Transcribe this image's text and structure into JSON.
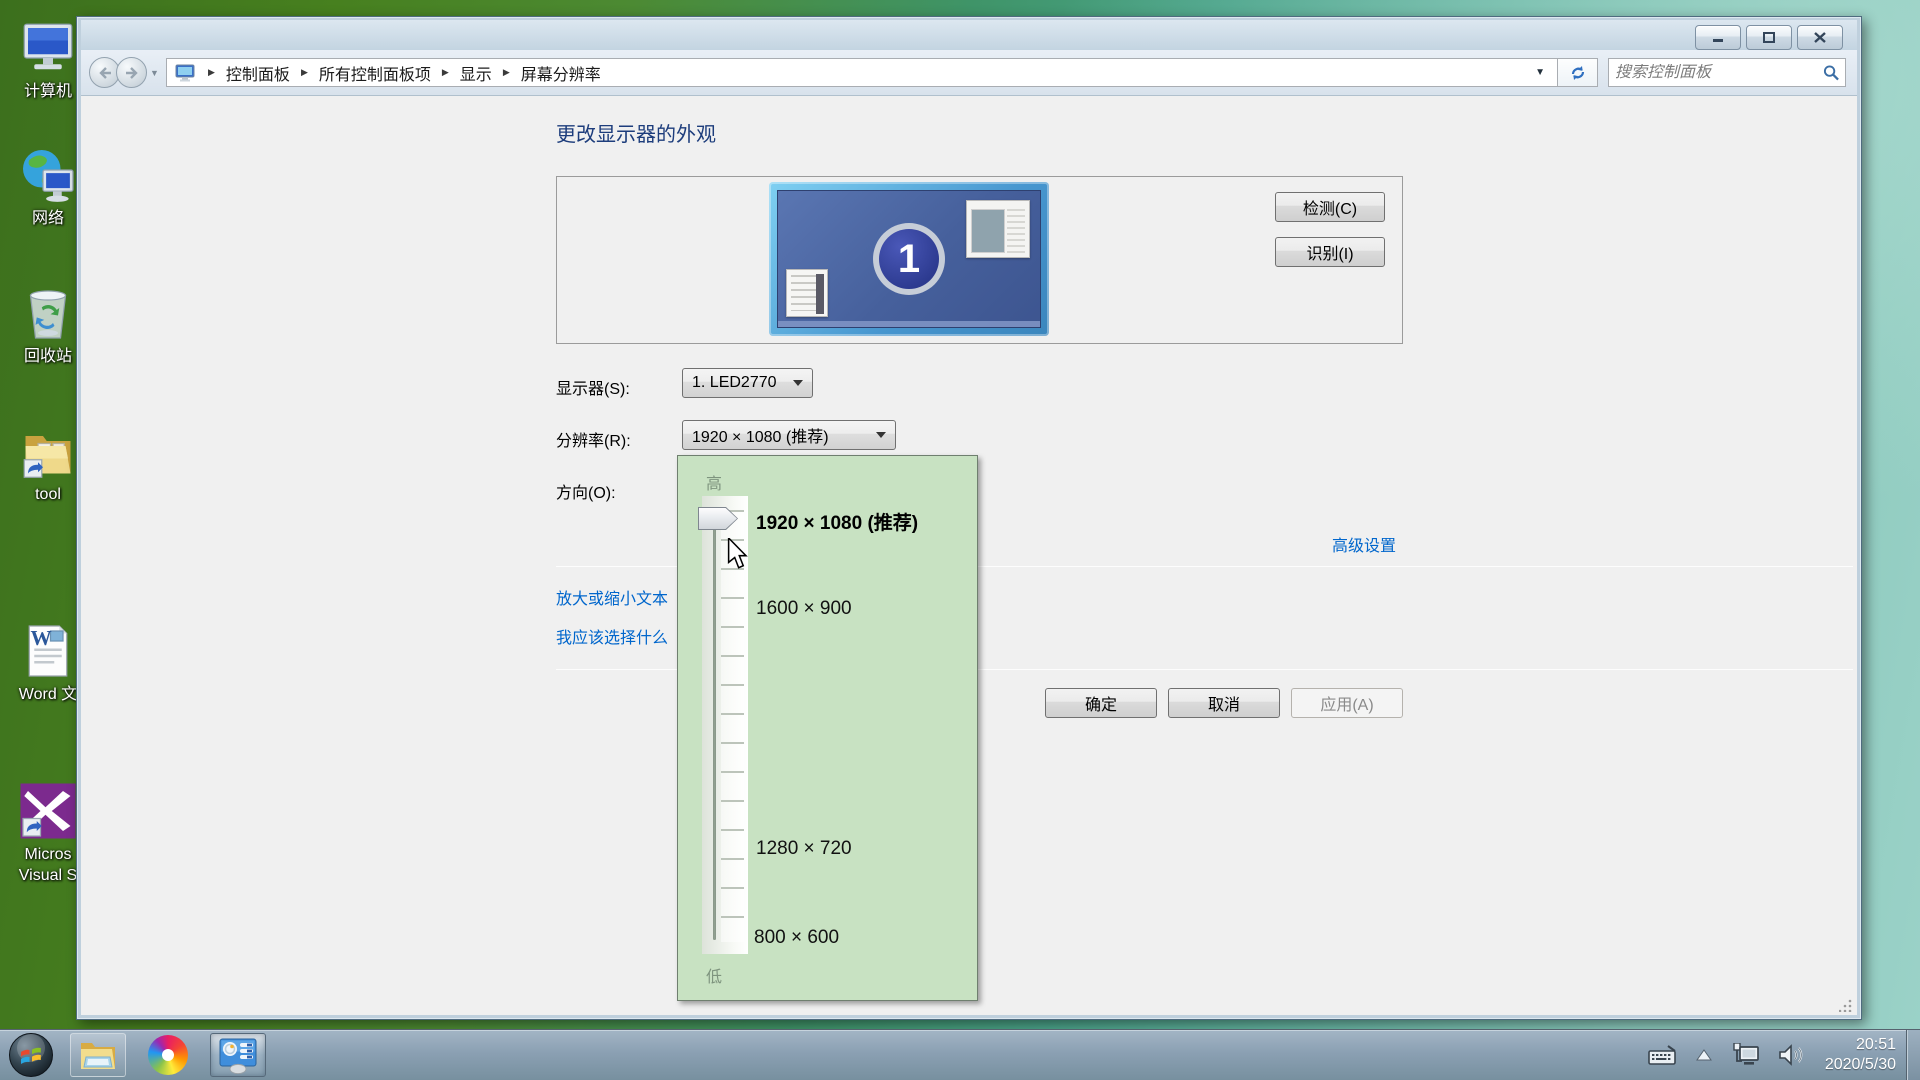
{
  "desktop": {
    "icons": [
      {
        "name": "computer",
        "label": "计算机"
      },
      {
        "name": "network",
        "label": "网络"
      },
      {
        "name": "recycle-bin",
        "label": "回收站"
      },
      {
        "name": "tool-folder",
        "label": "tool"
      },
      {
        "name": "word-doc",
        "label": "Word 文"
      },
      {
        "name": "visual-studio",
        "label": "Micros",
        "label2": "Visual S"
      }
    ]
  },
  "window": {
    "breadcrumb": {
      "items": [
        "控制面板",
        "所有控制面板项",
        "显示",
        "屏幕分辨率"
      ]
    },
    "search": {
      "placeholder": "搜索控制面板"
    },
    "page_title": "更改显示器的外观",
    "monitor_number": "1",
    "buttons": {
      "detect": "检测(C)",
      "identify": "识别(I)",
      "ok": "确定",
      "cancel": "取消",
      "apply": "应用(A)"
    },
    "fields": {
      "display_label": "显示器(S):",
      "display_value": "1. LED2770",
      "resolution_label": "分辨率(R):",
      "resolution_value": "1920 × 1080 (推荐)",
      "orientation_label": "方向(O):"
    },
    "links": {
      "advanced": "高级设置",
      "resize_text": "放大或缩小文本",
      "what_to_choose": "我应该选择什么"
    }
  },
  "resolution_dropdown": {
    "high": "高",
    "low": "低",
    "options": [
      {
        "label": "1920 × 1080 (推荐)",
        "selected": true
      },
      {
        "label": "1600 × 900",
        "selected": false
      },
      {
        "label": "1280 × 720",
        "selected": false
      },
      {
        "label": "800 × 600",
        "selected": false
      }
    ]
  },
  "taskbar": {
    "time": "20:51",
    "date": "2020/5/30"
  },
  "colors": {
    "link": "#0066cc",
    "panel_green": "#c8e2c2",
    "monitor_blue": "#46609c",
    "taskbar_gray_blue": "#8ba0b3"
  }
}
